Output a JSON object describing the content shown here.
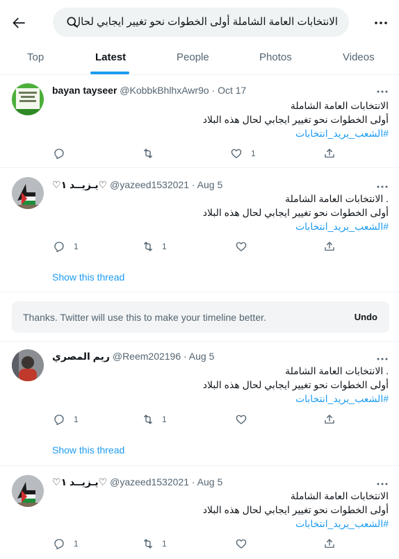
{
  "search": {
    "query": "الانتخابات العامة الشاملة أولى الخطوات نحو تغيير ايجابي لحال"
  },
  "tabs": [
    "Top",
    "Latest",
    "People",
    "Photos",
    "Videos"
  ],
  "tweets": [
    {
      "name": "bayan tayseer",
      "meta": "@KobbkBhlhxAwr9o · Oct 17",
      "lines": [
        "الانتخابات العامة الشاملة",
        "أولى الخطوات نحو تغيير ايجابي لحال هذه البلاد"
      ],
      "hashtag": "#الشعب_يريد_انتخابات",
      "replies": "",
      "retweets": "",
      "likes": "1"
    },
    {
      "name": "♡يـزيــد ١♡",
      "meta": "@yazeed1532021 · Aug 5",
      "lines": [
        ". الانتخابات العامة الشاملة",
        "أولى الخطوات نحو تغيير ايجابي لحال هذه البلاد"
      ],
      "hashtag": "#الشعب_يريد_انتخابات",
      "replies": "1",
      "retweets": "1",
      "likes": "",
      "show_thread": "Show this thread"
    },
    {
      "name": "ريم المصري",
      "meta": "@Reem202196 · Aug 5",
      "lines": [
        ". الانتخابات العامة الشاملة",
        "أولى الخطوات نحو تغيير ايجابي لحال هذه البلاد"
      ],
      "hashtag": "#الشعب_يريد_انتخابات",
      "replies": "1",
      "retweets": "1",
      "likes": "",
      "show_thread": "Show this thread"
    },
    {
      "name": "♡يـزيــد ١♡",
      "meta": "@yazeed1532021 · Aug 5",
      "lines": [
        "الانتخابات العامة الشاملة",
        "أولى الخطوات نحو تغيير ايجابي لحال هذه البلاد"
      ],
      "hashtag": "#الشعب_يريد_انتخابات",
      "replies": "1",
      "retweets": "1",
      "likes": ""
    }
  ],
  "notice": {
    "message": "Thanks. Twitter will use this to make your timeline better.",
    "undo": "Undo"
  },
  "colors": {
    "accent": "#1d9bf0",
    "secondary_text": "#536471",
    "notice_bg": "#f2f4f5"
  }
}
